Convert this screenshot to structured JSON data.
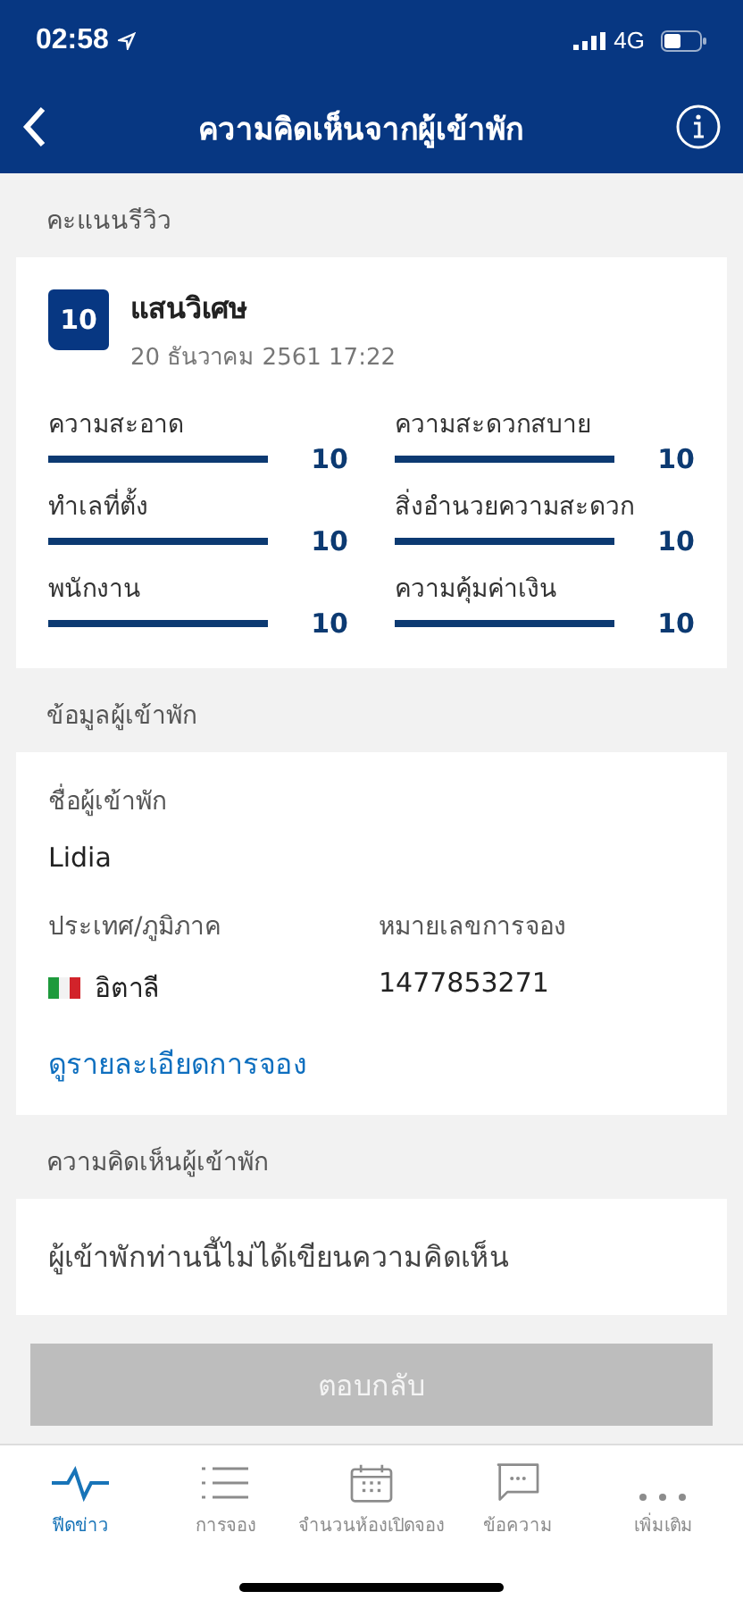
{
  "status_bar": {
    "time": "02:58",
    "network": "4G"
  },
  "nav": {
    "title": "ความคิดเห็นจากผู้เข้าพัก"
  },
  "review": {
    "header": "คะแนนรีวิว",
    "score": "10",
    "verdict": "แสนวิเศษ",
    "date": "20 ธันวาคม 2561 17:22",
    "ratings": [
      {
        "label": "ความสะอาด",
        "level": 1,
        "value": "10"
      },
      {
        "label": "ความสะดวกสบาย",
        "level": 1,
        "value": "10"
      },
      {
        "label": "ทำเลที่ตั้ง",
        "level": 1,
        "value": "10"
      },
      {
        "label": "สิ่งอำนวยความสะดวก",
        "level": 1,
        "value": "10"
      },
      {
        "label": "พนักงาน",
        "level": 1,
        "value": "10"
      },
      {
        "label": "ความคุ้มค่าเงิน",
        "level": 1,
        "value": "10"
      }
    ]
  },
  "guest": {
    "header": "ข้อมูลผู้เข้าพัก",
    "name_label": "ชื่อผู้เข้าพัก",
    "name": "Lidia",
    "country_label": "ประเทศ/ภูมิภาค",
    "country": "อิตาลี",
    "booking_label": "หมายเลขการจอง",
    "booking_number": "1477853271",
    "details_link": "ดูรายละเอียดการจอง"
  },
  "comment": {
    "header": "ความคิดเห็นผู้เข้าพัก",
    "text": "ผู้เข้าพักท่านนี้ไม่ได้เขียนความคิดเห็น"
  },
  "reply_button": {
    "label": "ตอบกลับ",
    "disabled": true
  },
  "tabs": [
    {
      "label": "ฟีดข่าว",
      "selected": true
    },
    {
      "label": "การจอง",
      "selected": false
    },
    {
      "label": "จำนวนห้องเปิดจอง",
      "selected": false
    },
    {
      "label": "ข้อความ",
      "selected": false
    },
    {
      "label": "เพิ่มเติม",
      "selected": false
    }
  ]
}
